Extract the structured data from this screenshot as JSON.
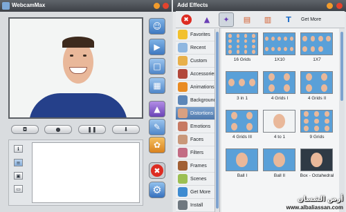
{
  "app": {
    "title": "WebcamMax"
  },
  "effects_panel": {
    "title": "Add Effects",
    "get_more": "Get More"
  },
  "controls": {
    "snapshot_icon": "camera-icon",
    "record_icon": "record-icon",
    "pause_icon": "pause-icon",
    "download_icon": "download-icon"
  },
  "categories": [
    {
      "label": "Favorites",
      "icon": "star-icon",
      "color": "#f2c12e"
    },
    {
      "label": "Recent",
      "icon": "clock-icon",
      "color": "#8fb7e0"
    },
    {
      "label": "Custom",
      "icon": "folder-icon",
      "color": "#e8b04a"
    },
    {
      "label": "Accessories",
      "icon": "hat-icon",
      "color": "#b2483a"
    },
    {
      "label": "Animations",
      "icon": "butterfly-icon",
      "color": "#e98b22"
    },
    {
      "label": "Backgrounds",
      "icon": "landscape-icon",
      "color": "#5c86b8"
    },
    {
      "label": "Distortions",
      "icon": "face-icon",
      "color": "#d9a081",
      "selected": true
    },
    {
      "label": "Emotions",
      "icon": "emotion-icon",
      "color": "#c77a63"
    },
    {
      "label": "Faces",
      "icon": "mask-icon",
      "color": "#c9987a"
    },
    {
      "label": "Filters",
      "icon": "filter-icon",
      "color": "#c36c84"
    },
    {
      "label": "Frames",
      "icon": "frame-icon",
      "color": "#a26034"
    },
    {
      "label": "Scenes",
      "icon": "scene-icon",
      "color": "#9cbf52"
    },
    {
      "label": "Get More",
      "icon": "globe-icon",
      "color": "#3e8bd1"
    },
    {
      "label": "Install",
      "icon": "install-icon",
      "color": "#6f7880"
    }
  ],
  "effects": [
    {
      "name": "16 Grids"
    },
    {
      "name": "1X10"
    },
    {
      "name": "1X7"
    },
    {
      "name": "3 in 1"
    },
    {
      "name": "4 Grids I"
    },
    {
      "name": "4 Grids II"
    },
    {
      "name": "4 Grids III"
    },
    {
      "name": "4 to 1"
    },
    {
      "name": "9 Grids"
    },
    {
      "name": "Ball I"
    },
    {
      "name": "Ball II"
    },
    {
      "name": "Box - Octahedral"
    }
  ],
  "watermark": {
    "arabic": "أرض الشسان",
    "url": "www.albaliassan.com"
  },
  "colors": {
    "title_bar": "#4b5056",
    "accent_blue": "#4f79ad",
    "preview_border": "#5a5e63"
  }
}
